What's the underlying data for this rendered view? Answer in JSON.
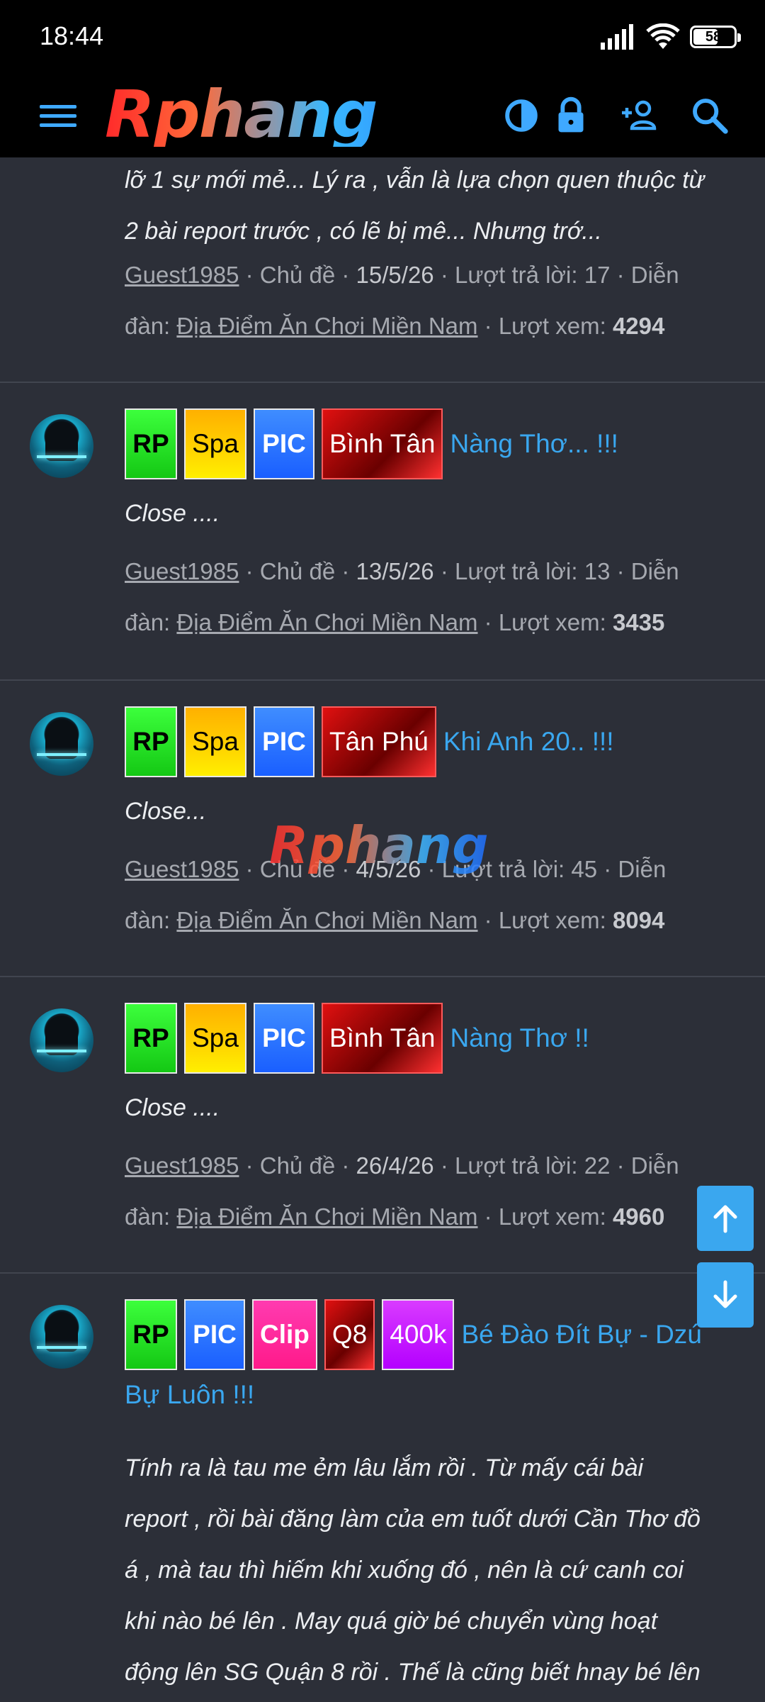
{
  "status_bar": {
    "time": "18:44",
    "battery_level": "58",
    "icons": [
      "signal-icon",
      "wifi-icon",
      "battery-icon"
    ]
  },
  "header": {
    "logo_text": "Rphang",
    "icons": [
      "menu-icon",
      "contrast-icon",
      "lock-icon",
      "add-user-icon",
      "search-icon"
    ]
  },
  "watermark": "Rphang",
  "first_thread_partial": {
    "snippet_line1": "lỡ 1 sự mới mẻ... Lý ra , vẫn là lựa chọn quen thuộc từ",
    "snippet_line2": "2 bài report trước , có lẽ bị mê... Nhưng trớ...",
    "author": "Guest1985",
    "type": "Chủ đề",
    "date": "15/5/26",
    "replies_label": "Lượt trả lời:",
    "replies": "17",
    "forum_label": "Diễn",
    "forum_label2": "đàn:",
    "forum": "Địa Điểm Ăn Chơi Miền Nam",
    "views_label": "Lượt xem:",
    "views": "4294"
  },
  "threads": [
    {
      "tags": [
        "RP",
        "Spa",
        "PIC",
        "Bình Tân"
      ],
      "title": "Nàng Thơ... !!!",
      "snippet": "Close ....",
      "author": "Guest1985",
      "type": "Chủ đề",
      "date": "13/5/26",
      "replies_label": "Lượt trả lời:",
      "replies": "13",
      "forum_label": "Diễn",
      "forum_label2": "đàn:",
      "forum": "Địa Điểm Ăn Chơi Miền Nam",
      "views_label": "Lượt xem:",
      "views": "3435"
    },
    {
      "tags": [
        "RP",
        "Spa",
        "PIC",
        "Tân Phú"
      ],
      "title": "Khi Anh 20.. !!!",
      "snippet": "Close...",
      "author": "Guest1985",
      "type": "Chủ đề",
      "date": "4/5/26",
      "replies_label": "Lượt trả lời:",
      "replies": "45",
      "forum_label": "Diễn",
      "forum_label2": "đàn:",
      "forum": "Địa Điểm Ăn Chơi Miền Nam",
      "views_label": "Lượt xem:",
      "views": "8094"
    },
    {
      "tags": [
        "RP",
        "Spa",
        "PIC",
        "Bình Tân"
      ],
      "title": "Nàng Thơ !!",
      "snippet": "Close ....",
      "author": "Guest1985",
      "type": "Chủ đề",
      "date": "26/4/26",
      "replies_label": "Lượt trả lời:",
      "replies": "22",
      "forum_label": "Diễn",
      "forum_label2": "đàn:",
      "forum": "Địa Điểm Ăn Chơi Miền Nam",
      "views_label": "Lượt xem:",
      "views": "4960"
    },
    {
      "tags": [
        "RP",
        "PIC",
        "Clip",
        "Q8",
        "400k"
      ],
      "title_part1": "Bé Đào Đít Bự - Dzú",
      "title_part2": "Bự Luôn !!!",
      "snippet_lines": [
        "Tính ra là tau me ẻm lâu lắm rồi . Từ mấy cái bài",
        "report , rồi bài đăng làm của em tuốt dưới Cần Thơ đồ",
        "á , mà tau thì hiếm khi xuống đó , nên là cứ canh coi",
        "khi nào bé lên . May quá giờ bé chuyển vùng hoạt",
        "động lên SG Quận 8 rồi . Thế là cũng biết hnay bé lên"
      ]
    }
  ],
  "colors": {
    "accent": "#3aa7ef",
    "background": "#2c2f38",
    "header_bg": "#000000"
  }
}
